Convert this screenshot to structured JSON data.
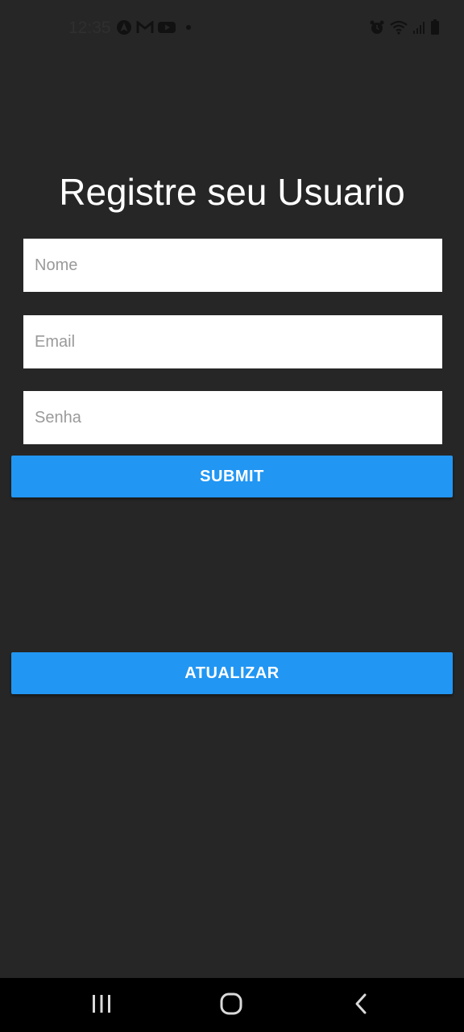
{
  "status_bar": {
    "time": "12:35",
    "left_icons": [
      "nav-arrow-app-icon",
      "gmail-icon",
      "youtube-icon",
      "dot-icon"
    ],
    "right_icons": [
      "alarm-icon",
      "wifi-icon",
      "signal-icon",
      "battery-icon"
    ]
  },
  "form": {
    "title": "Registre seu Usuario",
    "name_placeholder": "Nome",
    "email_placeholder": "Email",
    "password_placeholder": "Senha",
    "submit_label": "SUBMIT"
  },
  "update_label": "ATUALIZAR",
  "nav_bar": {
    "icons": [
      "recent-apps-icon",
      "home-icon",
      "back-icon"
    ]
  },
  "colors": {
    "background": "#262626",
    "button": "#2196f3",
    "field": "#ffffff",
    "nav_bar": "#000000"
  }
}
